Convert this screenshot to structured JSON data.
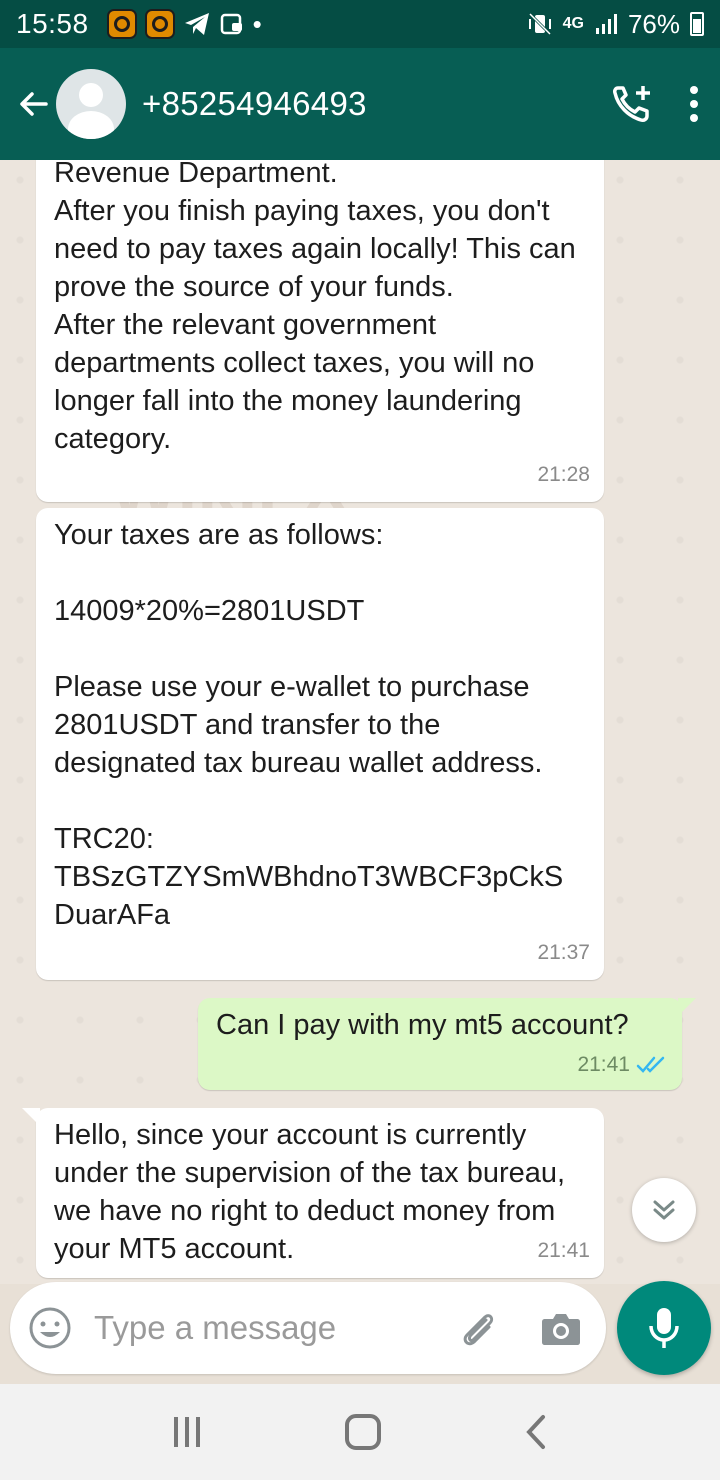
{
  "status_bar": {
    "time": "15:58",
    "network": "4G",
    "battery": "76%"
  },
  "header": {
    "contact": "+85254946493"
  },
  "messages": [
    {
      "direction": "incoming",
      "text": "Revenue Department.\nAfter you finish paying taxes, you don't need to pay taxes again locally! This can prove the source of your funds.\nAfter the relevant government departments collect taxes, you will no longer fall into the money laundering category.",
      "time": "21:28"
    },
    {
      "direction": "incoming",
      "text": "Your taxes are as follows:\n\n14009*20%=2801USDT\n\nPlease use your e-wallet to purchase 2801USDT and transfer to the designated tax bureau wallet address.\n\nTRC20:\nTBSzGTZYSmWBhdnoT3WBCF3pCkS DuarAFa",
      "time": "21:37"
    },
    {
      "direction": "outgoing",
      "text": "Can I pay with my mt5 account?",
      "time": "21:41",
      "status": "read"
    },
    {
      "direction": "incoming",
      "text": "Hello, since your account is currently under the supervision of the tax bureau, we have no right to deduct money from your MT5 account.",
      "time": "21:41"
    }
  ],
  "watermark": "WikiFX",
  "composer": {
    "placeholder": "Type a message"
  },
  "colors": {
    "header": "#075e54",
    "status_bar": "#054d44",
    "outgoing_bubble": "#dcf8c6",
    "mic_button": "#00897b",
    "read_ticks": "#34b7f1"
  }
}
